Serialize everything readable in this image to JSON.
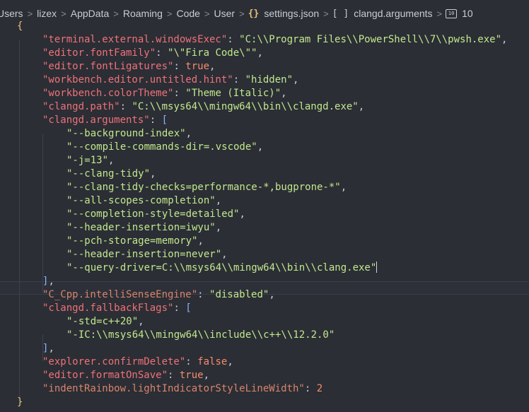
{
  "breadcrumb": {
    "items": [
      "Users",
      "lizex",
      "AppData",
      "Roaming",
      "Code",
      "User"
    ],
    "file": "settings.json",
    "symbol": "clangd.arguments",
    "index": "10"
  },
  "code": {
    "open_brace": "{",
    "close_brace": "}",
    "terminal_key": "\"terminal.external.windowsExec\"",
    "terminal_val": "\"C:\\\\Program Files\\\\PowerShell\\\\7\\\\pwsh.exe\"",
    "font_family_key": "\"editor.fontFamily\"",
    "font_family_val": "\"\\\"Fira Code\\\"\"",
    "ligatures_key": "\"editor.fontLigatures\"",
    "ligatures_val": "true",
    "untitled_key": "\"workbench.editor.untitled.hint\"",
    "untitled_val": "\"hidden\"",
    "theme_key": "\"workbench.colorTheme\"",
    "theme_val": "\"Theme (Italic)\"",
    "clangd_path_key": "\"clangd.path\"",
    "clangd_path_val": "\"C:\\\\msys64\\\\mingw64\\\\bin\\\\clangd.exe\"",
    "clangd_args_key": "\"clangd.arguments\"",
    "clangd_args": [
      "\"--background-index\"",
      "\"--compile-commands-dir=.vscode\"",
      "\"-j=13\"",
      "\"--clang-tidy\"",
      "\"--clang-tidy-checks=performance-*,bugprone-*\"",
      "\"--all-scopes-completion\"",
      "\"--completion-style=detailed\"",
      "\"--header-insertion=iwyu\"",
      "\"--pch-storage=memory\"",
      "\"--header-insertion=never\"",
      "\"--query-driver=C:\\\\msys64\\\\mingw64\\\\bin\\\\clang.exe\""
    ],
    "cpp_engine_key": "\"C_Cpp.intelliSenseEngine\"",
    "cpp_engine_val": "\"disabled\"",
    "fallback_key": "\"clangd.fallbackFlags\"",
    "fallback_flags": [
      "\"-std=c++20\"",
      "\"-IC:\\\\msys64\\\\mingw64\\\\include\\\\c++\\\\12.2.0\""
    ],
    "confirm_delete_key": "\"explorer.confirmDelete\"",
    "confirm_delete_val": "false",
    "format_save_key": "\"editor.formatOnSave\"",
    "format_save_val": "true",
    "indent_rainbow_key": "\"indentRainbow.lightIndicatorStyleLineWidth\"",
    "indent_rainbow_val": "2"
  },
  "colors": {
    "background": "#2b2e35",
    "key": "#f07178",
    "string": "#c3e88d",
    "literal": "#f78c6c",
    "bracket": "#e5c07b"
  }
}
